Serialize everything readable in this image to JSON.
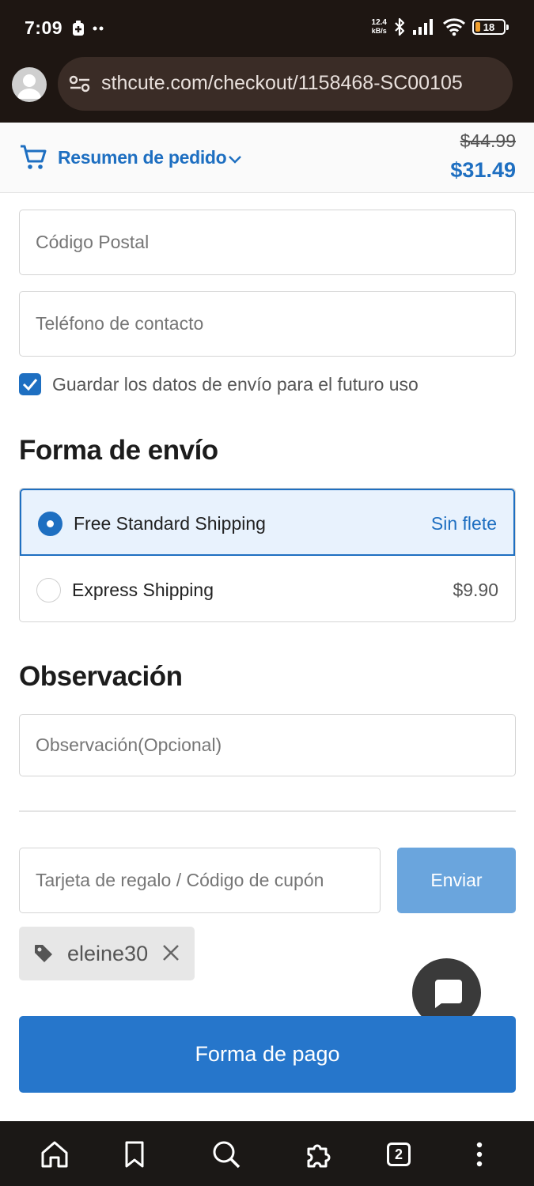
{
  "status_bar": {
    "time": "7:09",
    "net_speed_value": "12.4",
    "net_speed_unit": "kB/s",
    "battery": "18"
  },
  "browser": {
    "url": "sthcute.com/checkout/1158468-SC00105"
  },
  "summary": {
    "label": "Resumen de pedido",
    "price_original": "$44.99",
    "price_total": "$31.49"
  },
  "form": {
    "postal_code_placeholder": "Código Postal",
    "phone_placeholder": "Teléfono de contacto",
    "save_data_label": "Guardar los datos de envío para el futuro uso",
    "save_data_checked": true
  },
  "shipping": {
    "title": "Forma de envío",
    "options": [
      {
        "name": "Free Standard Shipping",
        "price": "Sin flete",
        "selected": true
      },
      {
        "name": "Express Shipping",
        "price": "$9.90",
        "selected": false
      }
    ]
  },
  "observation": {
    "title": "Observación",
    "placeholder": "Observación(Opcional)"
  },
  "coupon": {
    "placeholder": "Tarjeta de regalo / Código de cupón",
    "submit_label": "Enviar",
    "applied_code": "eleine30"
  },
  "payment_button": "Forma de pago",
  "nav": {
    "tabs_count": "2"
  },
  "colors": {
    "accent": "#1e6fc1",
    "button_primary": "#2676cb",
    "button_light": "#6aa5dd"
  }
}
